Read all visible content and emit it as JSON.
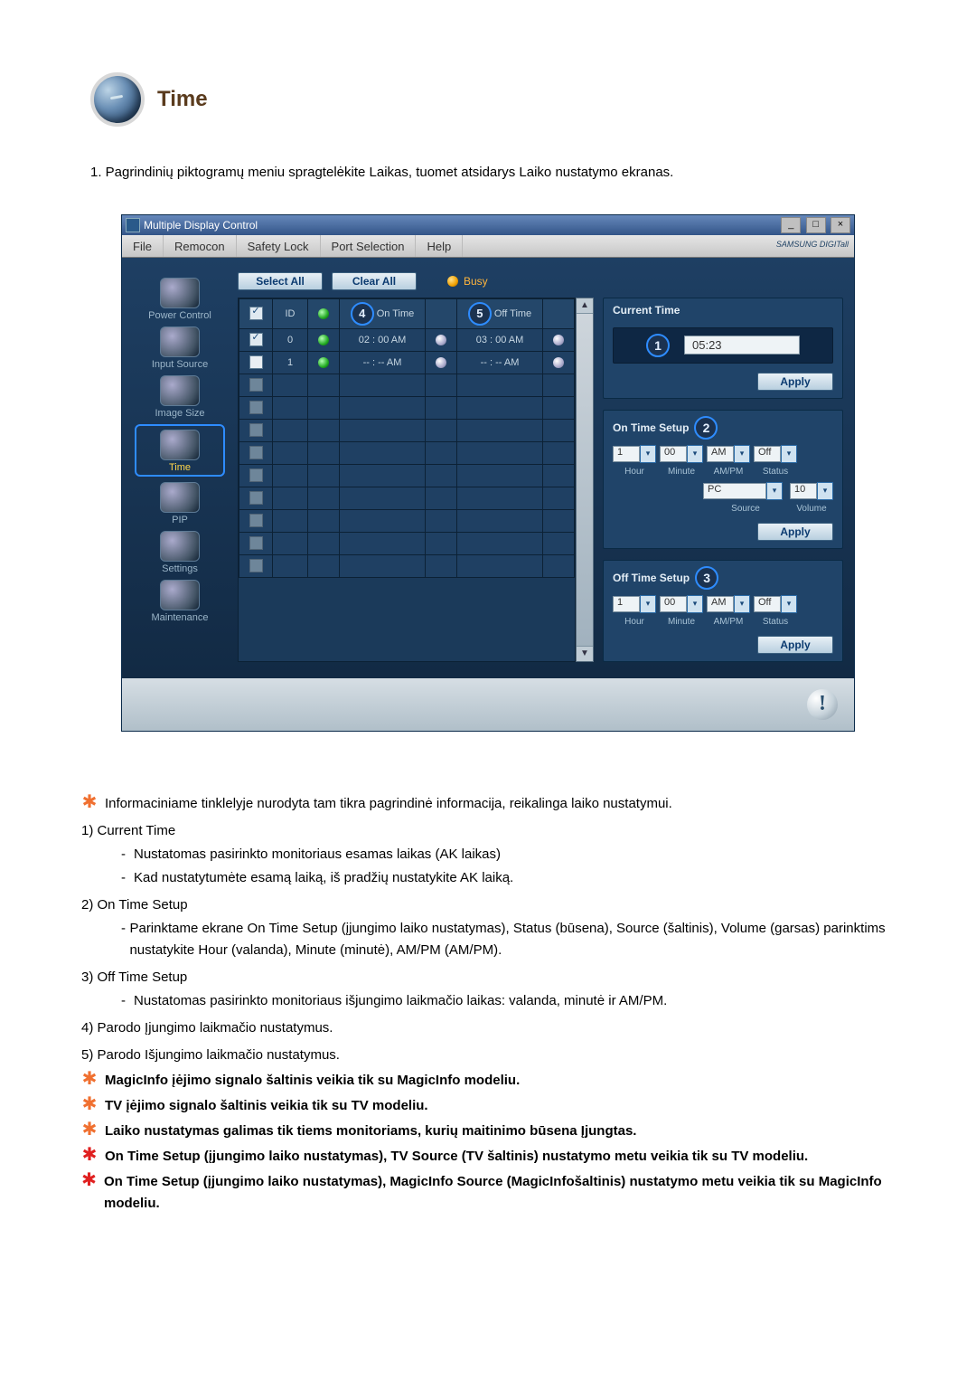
{
  "section_title": "Time",
  "intro": "1. Pagrindinių piktogramų meniu spragtelėkite Laikas, tuomet atsidarys Laiko nustatymo ekranas.",
  "window": {
    "title": "Multiple Display Control",
    "menus": [
      "File",
      "Remocon",
      "Safety Lock",
      "Port Selection",
      "Help"
    ],
    "brand": "SAMSUNG DIGITall",
    "nav": [
      {
        "label": "Power Control"
      },
      {
        "label": "Input Source"
      },
      {
        "label": "Image Size"
      },
      {
        "label": "Time"
      },
      {
        "label": "PIP"
      },
      {
        "label": "Settings"
      },
      {
        "label": "Maintenance"
      }
    ],
    "buttons": {
      "select_all": "Select All",
      "clear_all": "Clear All",
      "busy": "Busy"
    },
    "table": {
      "headers": {
        "id": "ID",
        "on_time": "On Time",
        "off_time": "Off Time"
      },
      "callouts": {
        "on": "4",
        "off": "5"
      },
      "rows": [
        {
          "checked": true,
          "disabled": false,
          "id": "0",
          "st": "green",
          "on": "02 : 00 AM",
          "ist1": "white",
          "off": "03 : 00 AM",
          "ist2": "white"
        },
        {
          "checked": false,
          "disabled": false,
          "id": "1",
          "st": "green",
          "on": "-- : -- AM",
          "ist1": "white",
          "off": "-- : -- AM",
          "ist2": "white"
        },
        {
          "checked": false,
          "disabled": true,
          "id": "",
          "st": "",
          "on": "",
          "ist1": "",
          "off": "",
          "ist2": ""
        },
        {
          "checked": false,
          "disabled": true,
          "id": "",
          "st": "",
          "on": "",
          "ist1": "",
          "off": "",
          "ist2": ""
        },
        {
          "checked": false,
          "disabled": true,
          "id": "",
          "st": "",
          "on": "",
          "ist1": "",
          "off": "",
          "ist2": ""
        },
        {
          "checked": false,
          "disabled": true,
          "id": "",
          "st": "",
          "on": "",
          "ist1": "",
          "off": "",
          "ist2": ""
        },
        {
          "checked": false,
          "disabled": true,
          "id": "",
          "st": "",
          "on": "",
          "ist1": "",
          "off": "",
          "ist2": ""
        },
        {
          "checked": false,
          "disabled": true,
          "id": "",
          "st": "",
          "on": "",
          "ist1": "",
          "off": "",
          "ist2": ""
        },
        {
          "checked": false,
          "disabled": true,
          "id": "",
          "st": "",
          "on": "",
          "ist1": "",
          "off": "",
          "ist2": ""
        },
        {
          "checked": false,
          "disabled": true,
          "id": "",
          "st": "",
          "on": "",
          "ist1": "",
          "off": "",
          "ist2": ""
        },
        {
          "checked": false,
          "disabled": true,
          "id": "",
          "st": "",
          "on": "",
          "ist1": "",
          "off": "",
          "ist2": ""
        }
      ]
    },
    "panels": {
      "current_time": {
        "title": "Current Time",
        "num": "1",
        "value": "05:23",
        "apply": "Apply"
      },
      "on_time": {
        "title": "On Time Setup",
        "num": "2",
        "hour": "1",
        "minute": "00",
        "ampm": "AM",
        "status": "Off",
        "source": "PC",
        "volume": "10",
        "labels": {
          "hour": "Hour",
          "minute": "Minute",
          "ampm": "AM/PM",
          "status": "Status",
          "source": "Source",
          "volume": "Volume"
        },
        "apply": "Apply"
      },
      "off_time": {
        "title": "Off Time Setup",
        "num": "3",
        "hour": "1",
        "minute": "00",
        "ampm": "AM",
        "status": "Off",
        "labels": {
          "hour": "Hour",
          "minute": "Minute",
          "ampm": "AM/PM",
          "status": "Status"
        },
        "apply": "Apply"
      }
    },
    "status_icon": "!"
  },
  "copy": {
    "star1": "Informaciniame tinklelyje nurodyta tam tikra pagrindinė informacija, reikalinga laiko nustatymui.",
    "n1": "1)  Current Time",
    "n1a": "Nustatomas pasirinkto monitoriaus esamas laikas (AK laikas)",
    "n1b": "Kad nustatytumėte esamą laiką, iš pradžių nustatykite AK laiką.",
    "n2": "2)  On Time Setup",
    "n2a": "Parinktame ekrane On Time Setup (įjungimo laiko nustatymas), Status (būsena), Source (šaltinis), Volume (garsas) parinktims nustatykite Hour (valanda), Minute (minutė), AM/PM (AM/PM).",
    "n3": "3)  Off Time Setup",
    "n3a": "Nustatomas pasirinkto monitoriaus išjungimo laikmačio laikas: valanda, minutė ir AM/PM.",
    "n4": "4)  Parodo Įjungimo laikmačio nustatymus.",
    "n5": "5)  Parodo Išjungimo laikmačio nustatymus.",
    "star2": "MagicInfo įėjimo signalo šaltinis veikia tik su MagicInfo modeliu.",
    "star3": "TV įėjimo signalo šaltinis veikia tik su TV modeliu.",
    "star4": "Laiko nustatymas galimas tik tiems monitoriams, kurių maitinimo būsena Įjungtas.",
    "star5": "On Time Setup (įjungimo laiko nustatymas), TV Source (TV šaltinis) nustatymo metu veikia tik su TV modeliu.",
    "star6": "On Time Setup (įjungimo laiko nustatymas), MagicInfo Source (MagicInfošaltinis) nustatymo metu veikia tik su MagicInfo modeliu."
  }
}
